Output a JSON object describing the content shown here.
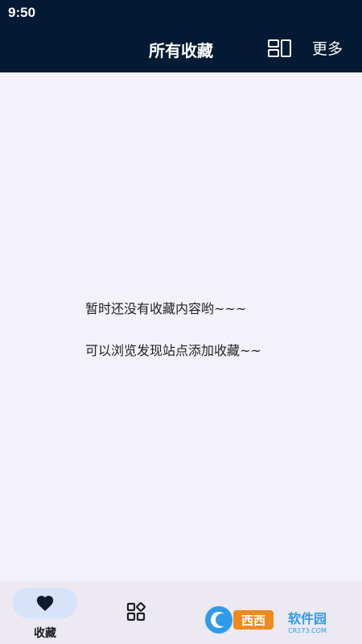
{
  "status_bar": {
    "time": "9:50"
  },
  "app_bar": {
    "title": "所有收藏",
    "layout_toggle_icon": "layout-grid-icon",
    "more_label": "更多"
  },
  "empty_state": {
    "line1": "暂时还没有收藏内容哟~~~",
    "line2": "可以浏览发现站点添加收藏~~"
  },
  "bottom_nav": {
    "items": [
      {
        "label": "收藏",
        "icon": "heart-icon",
        "selected": true
      },
      {
        "label": "",
        "icon": "apps-icon",
        "selected": false
      }
    ]
  },
  "colors": {
    "header_bg": "#021a33",
    "content_bg": "#f3f2f8",
    "nav_bg": "#ece9f2",
    "nav_selected_pill": "#d6e3fb",
    "text_primary": "#1f1f24"
  }
}
